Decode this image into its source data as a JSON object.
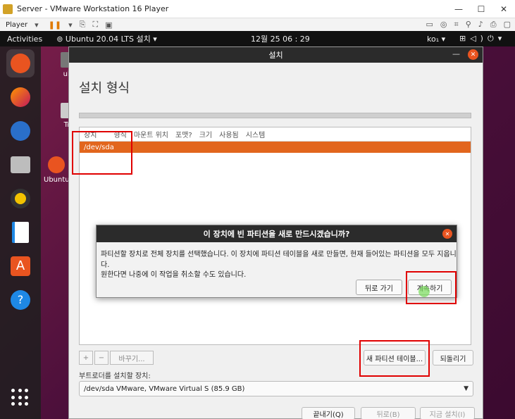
{
  "vm": {
    "title": "Server - VMware Workstation 16 Player",
    "player_label": "Player",
    "win_minimize": "—",
    "win_maximize": "☐",
    "win_close": "✕"
  },
  "topbar": {
    "activities": "Activities",
    "app_menu": "Ubuntu 20.04 LTS 설치",
    "clock": "12월 25  06 : 29",
    "keyboard": "ko₁"
  },
  "desktop": {
    "icon1_label": "ub",
    "icon2_label": "Tr",
    "icon3_label": "Ubuntu"
  },
  "installer": {
    "window_title": "설치",
    "page_title": "설치 형식",
    "columns": [
      "장치",
      "형식",
      "마운트 위치",
      "포맷?",
      "크기",
      "사용됨",
      "시스템"
    ],
    "selected_device": "/dev/sda",
    "add_btn": "+",
    "remove_btn": "−",
    "change_btn": "바꾸기...",
    "new_table_btn": "새 파티션 테이블...",
    "revert_btn": "되돌리기",
    "bootloader_label": "부트로더를 설치할 장치:",
    "bootloader_value": "/dev/sda VMware, VMware Virtual S (85.9 GB)",
    "quit_btn": "끝내기(Q)",
    "back_btn": "뒤로(B)",
    "install_btn": "지금 설치(I)"
  },
  "dialog": {
    "title": "이 장치에 빈 파티션을 새로 만드시겠습니까?",
    "message1": "파티션할 장치로 전체 장치를 선택했습니다. 이 장치에 파티션 테이블을 새로 만들면, 현재 들어있는 파티션을 모두 지웁니다.",
    "message2": "원한다면 나중에 이 작업을 취소할 수도 있습니다.",
    "back_btn": "뒤로 가기",
    "continue_btn": "계속하기"
  },
  "colors": {
    "accent": "#e95420",
    "selection": "#e2661d",
    "highlight_box": "#e00000"
  }
}
